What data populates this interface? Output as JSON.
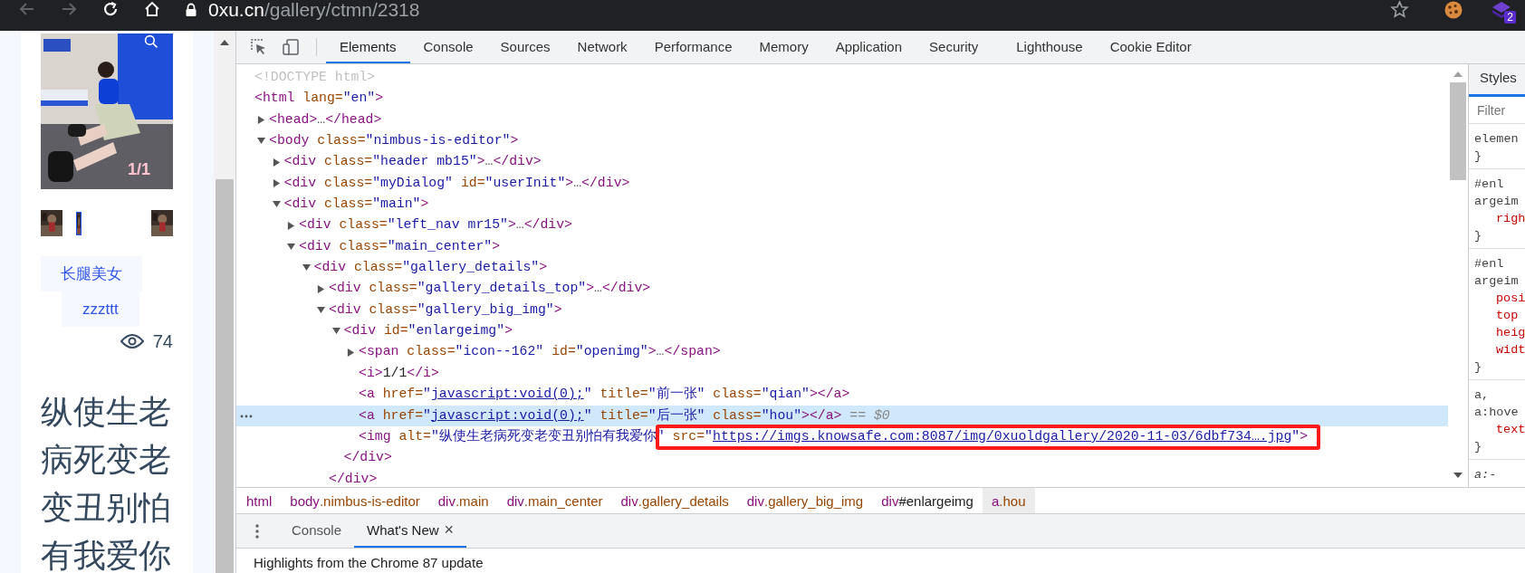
{
  "browser": {
    "nav": [
      {
        "kind": "back",
        "disabled": true
      },
      {
        "kind": "forward",
        "disabled": true
      },
      {
        "kind": "reload",
        "disabled": false
      },
      {
        "kind": "home",
        "disabled": false
      }
    ],
    "url_host": "0xu.cn",
    "url_path": "/gallery/ctmn/2318",
    "extension_badge": "2"
  },
  "page": {
    "image_counter": "1/1",
    "thumbnails": [
      {
        "selected": false
      },
      {
        "selected": true
      },
      {
        "selected": false
      }
    ],
    "tags": [
      {
        "label": "长腿美女"
      },
      {
        "label": "zzzttt"
      }
    ],
    "views": "74",
    "title": "纵使生老病死变老变丑别怕有我爱你"
  },
  "devtools": {
    "tabs": [
      {
        "label": "Elements",
        "selected": true
      },
      {
        "label": "Console",
        "selected": false
      },
      {
        "label": "Sources",
        "selected": false
      },
      {
        "label": "Network",
        "selected": false
      },
      {
        "label": "Performance",
        "selected": false
      },
      {
        "label": "Memory",
        "selected": false
      },
      {
        "label": "Application",
        "selected": false
      },
      {
        "label": "Security",
        "selected": false
      },
      {
        "label": "Lighthouse",
        "selected": false
      },
      {
        "label": "Cookie Editor",
        "selected": false
      }
    ],
    "elements": {
      "nodes": [
        {
          "parts": [
            {
              "kind": "doctype",
              "text": "<!DOCTYPE html>"
            }
          ]
        },
        {
          "parts": [
            {
              "kind": "tag",
              "text": "<html"
            },
            {
              "kind": "attr",
              "text": " lang="
            },
            {
              "kind": "value",
              "text": "\"en\""
            },
            {
              "kind": "tag",
              "text": ">"
            }
          ],
          "children": [
            {
              "expanded": false,
              "parts": [
                {
                  "kind": "tag",
                  "text": "<head>"
                },
                {
                  "kind": "text",
                  "text": "…"
                },
                {
                  "kind": "tag",
                  "text": "</head>"
                }
              ]
            },
            {
              "expanded": true,
              "parts": [
                {
                  "kind": "tag",
                  "text": "<body"
                },
                {
                  "kind": "attr",
                  "text": " class="
                },
                {
                  "kind": "value",
                  "text": "\"nimbus-is-editor\""
                },
                {
                  "kind": "tag",
                  "text": ">"
                }
              ],
              "children": [
                {
                  "expanded": false,
                  "parts": [
                    {
                      "kind": "tag",
                      "text": "<div"
                    },
                    {
                      "kind": "attr",
                      "text": " class="
                    },
                    {
                      "kind": "value",
                      "text": "\"header mb15\""
                    },
                    {
                      "kind": "tag",
                      "text": ">"
                    },
                    {
                      "kind": "text",
                      "text": "…"
                    },
                    {
                      "kind": "tag",
                      "text": "</div>"
                    }
                  ]
                },
                {
                  "expanded": false,
                  "parts": [
                    {
                      "kind": "tag",
                      "text": "<div"
                    },
                    {
                      "kind": "attr",
                      "text": " class="
                    },
                    {
                      "kind": "value",
                      "text": "\"myDialog\""
                    },
                    {
                      "kind": "attr",
                      "text": " id="
                    },
                    {
                      "kind": "value",
                      "text": "\"userInit\""
                    },
                    {
                      "kind": "tag",
                      "text": ">"
                    },
                    {
                      "kind": "text",
                      "text": "…"
                    },
                    {
                      "kind": "tag",
                      "text": "</div>"
                    }
                  ]
                },
                {
                  "expanded": true,
                  "parts": [
                    {
                      "kind": "tag",
                      "text": "<div"
                    },
                    {
                      "kind": "attr",
                      "text": " class="
                    },
                    {
                      "kind": "value",
                      "text": "\"main\""
                    },
                    {
                      "kind": "tag",
                      "text": ">"
                    }
                  ],
                  "children": [
                    {
                      "expanded": false,
                      "parts": [
                        {
                          "kind": "tag",
                          "text": "<div"
                        },
                        {
                          "kind": "attr",
                          "text": " class="
                        },
                        {
                          "kind": "value",
                          "text": "\"left_nav mr15\""
                        },
                        {
                          "kind": "tag",
                          "text": ">"
                        },
                        {
                          "kind": "text",
                          "text": "…"
                        },
                        {
                          "kind": "tag",
                          "text": "</div>"
                        }
                      ]
                    },
                    {
                      "expanded": true,
                      "parts": [
                        {
                          "kind": "tag",
                          "text": "<div"
                        },
                        {
                          "kind": "attr",
                          "text": " class="
                        },
                        {
                          "kind": "value",
                          "text": "\"main_center\""
                        },
                        {
                          "kind": "tag",
                          "text": ">"
                        }
                      ],
                      "children": [
                        {
                          "expanded": true,
                          "parts": [
                            {
                              "kind": "tag",
                              "text": "<div"
                            },
                            {
                              "kind": "attr",
                              "text": " class="
                            },
                            {
                              "kind": "value",
                              "text": "\"gallery_details\""
                            },
                            {
                              "kind": "tag",
                              "text": ">"
                            }
                          ],
                          "children": [
                            {
                              "expanded": false,
                              "parts": [
                                {
                                  "kind": "tag",
                                  "text": "<div"
                                },
                                {
                                  "kind": "attr",
                                  "text": " class="
                                },
                                {
                                  "kind": "value",
                                  "text": "\"gallery_details_top\""
                                },
                                {
                                  "kind": "tag",
                                  "text": ">"
                                },
                                {
                                  "kind": "text",
                                  "text": "…"
                                },
                                {
                                  "kind": "tag",
                                  "text": "</div>"
                                }
                              ]
                            },
                            {
                              "expanded": true,
                              "close": "</div>",
                              "parts": [
                                {
                                  "kind": "tag",
                                  "text": "<div"
                                },
                                {
                                  "kind": "attr",
                                  "text": " class="
                                },
                                {
                                  "kind": "value",
                                  "text": "\"gallery_big_img\""
                                },
                                {
                                  "kind": "tag",
                                  "text": ">"
                                }
                              ],
                              "children": [
                                {
                                  "expanded": true,
                                  "close": "</div>",
                                  "parts": [
                                    {
                                      "kind": "tag",
                                      "text": "<div"
                                    },
                                    {
                                      "kind": "attr",
                                      "text": " id="
                                    },
                                    {
                                      "kind": "value",
                                      "text": "\"enlargeimg\""
                                    },
                                    {
                                      "kind": "tag",
                                      "text": ">"
                                    }
                                  ],
                                  "children": [
                                    {
                                      "expanded": false,
                                      "parts": [
                                        {
                                          "kind": "tag",
                                          "text": "<span"
                                        },
                                        {
                                          "kind": "attr",
                                          "text": " class="
                                        },
                                        {
                                          "kind": "value",
                                          "text": "\"icon--162\""
                                        },
                                        {
                                          "kind": "attr",
                                          "text": " id="
                                        },
                                        {
                                          "kind": "value",
                                          "text": "\"openimg\""
                                        },
                                        {
                                          "kind": "tag",
                                          "text": ">"
                                        },
                                        {
                                          "kind": "text",
                                          "text": "…"
                                        },
                                        {
                                          "kind": "tag",
                                          "text": "</span>"
                                        }
                                      ]
                                    },
                                    {
                                      "parts": [
                                        {
                                          "kind": "tag",
                                          "text": "<i>"
                                        },
                                        {
                                          "kind": "plain",
                                          "text": "1/1"
                                        },
                                        {
                                          "kind": "tag",
                                          "text": "</i>"
                                        }
                                      ]
                                    },
                                    {
                                      "selected": false,
                                      "parts": [
                                        {
                                          "kind": "tag",
                                          "text": "<a"
                                        },
                                        {
                                          "kind": "attr",
                                          "text": " href="
                                        },
                                        {
                                          "kind": "value",
                                          "text": "\""
                                        },
                                        {
                                          "kind": "link",
                                          "text": "javascript:void(0);"
                                        },
                                        {
                                          "kind": "value",
                                          "text": "\""
                                        },
                                        {
                                          "kind": "attr",
                                          "text": " title="
                                        },
                                        {
                                          "kind": "value",
                                          "text": "\"前一张\""
                                        },
                                        {
                                          "kind": "attr",
                                          "text": " class="
                                        },
                                        {
                                          "kind": "value",
                                          "text": "\"qian\""
                                        },
                                        {
                                          "kind": "tag",
                                          "text": "></a>"
                                        }
                                      ]
                                    },
                                    {
                                      "selected": true,
                                      "parts": [
                                        {
                                          "kind": "tag",
                                          "text": "<a"
                                        },
                                        {
                                          "kind": "attr",
                                          "text": " href="
                                        },
                                        {
                                          "kind": "value",
                                          "text": "\""
                                        },
                                        {
                                          "kind": "link",
                                          "text": "javascript:void(0);"
                                        },
                                        {
                                          "kind": "value",
                                          "text": "\""
                                        },
                                        {
                                          "kind": "attr",
                                          "text": " title="
                                        },
                                        {
                                          "kind": "value",
                                          "text": "\"后一张\""
                                        },
                                        {
                                          "kind": "attr",
                                          "text": " class="
                                        },
                                        {
                                          "kind": "value",
                                          "text": "\"hou\""
                                        },
                                        {
                                          "kind": "tag",
                                          "text": "></a>"
                                        },
                                        {
                                          "kind": "hint",
                                          "text": " == $0"
                                        }
                                      ]
                                    },
                                    {
                                      "parts": [
                                        {
                                          "kind": "tag",
                                          "text": "<img"
                                        },
                                        {
                                          "kind": "attr",
                                          "text": " alt="
                                        },
                                        {
                                          "kind": "value",
                                          "text": "\"纵使生老病死变老变丑别怕有我爱你\""
                                        },
                                        {
                                          "kind": "attr",
                                          "text": " src=",
                                          "boxed": true
                                        },
                                        {
                                          "kind": "value",
                                          "text": "\"",
                                          "boxed": true
                                        },
                                        {
                                          "kind": "link",
                                          "text": "https://imgs.knowsafe.com:8087/img/0xuoldgallery/2020-11-03/6dbf734….jpg",
                                          "boxed": true
                                        },
                                        {
                                          "kind": "value",
                                          "text": "\"",
                                          "boxed": true
                                        },
                                        {
                                          "kind": "tag",
                                          "text": ">",
                                          "boxed": true
                                        }
                                      ]
                                    }
                                  ]
                                }
                              ]
                            }
                          ]
                        }
                      ]
                    }
                  ]
                }
              ]
            }
          ]
        }
      ]
    },
    "styles": {
      "tab": "Styles",
      "filter_placeholder": "Filter",
      "rules": [
        {
          "lines": [
            {
              "kind": "selector",
              "text": "elemen"
            },
            {
              "kind": "brace",
              "text": "}"
            }
          ]
        },
        {
          "lines": [
            {
              "kind": "selector",
              "text": "#enl"
            },
            {
              "kind": "selector",
              "text": "argeim"
            },
            {
              "kind": "property",
              "text": "righ"
            },
            {
              "kind": "brace",
              "text": "}"
            }
          ]
        },
        {
          "lines": [
            {
              "kind": "selector",
              "text": "#enl"
            },
            {
              "kind": "selector",
              "text": "argeim"
            },
            {
              "kind": "property",
              "text": "posi"
            },
            {
              "kind": "property",
              "text": "top"
            },
            {
              "kind": "property",
              "text": "heig"
            },
            {
              "kind": "property",
              "text": "widt"
            },
            {
              "kind": "brace",
              "text": "}"
            }
          ]
        },
        {
          "lines": [
            {
              "kind": "selector",
              "text": "a,"
            },
            {
              "kind": "selector",
              "text": "a:hove"
            },
            {
              "kind": "property",
              "text": "text"
            },
            {
              "kind": "brace",
              "text": "}"
            }
          ]
        },
        {
          "lines": [
            {
              "kind": "ua_selector",
              "text": "a:-"
            }
          ]
        }
      ]
    },
    "breadcrumbs": [
      {
        "tag": "html",
        "selected": false
      },
      {
        "tag": "body",
        "class": ".nimbus-is-editor",
        "selected": false
      },
      {
        "tag": "div",
        "class": ".main",
        "selected": false
      },
      {
        "tag": "div",
        "class": ".main_center",
        "selected": false
      },
      {
        "tag": "div",
        "class": ".gallery_details",
        "selected": false
      },
      {
        "tag": "div",
        "class": ".gallery_big_img",
        "selected": false
      },
      {
        "tag": "div",
        "id": "#enlargeimg",
        "selected": false
      },
      {
        "tag": "a",
        "class": ".hou",
        "selected": true
      }
    ],
    "drawer": {
      "tabs": [
        {
          "label": "Console",
          "selected": false
        },
        {
          "label": "What's New",
          "selected": true,
          "close": "×"
        }
      ],
      "content": "Highlights from the Chrome 87 update"
    }
  }
}
